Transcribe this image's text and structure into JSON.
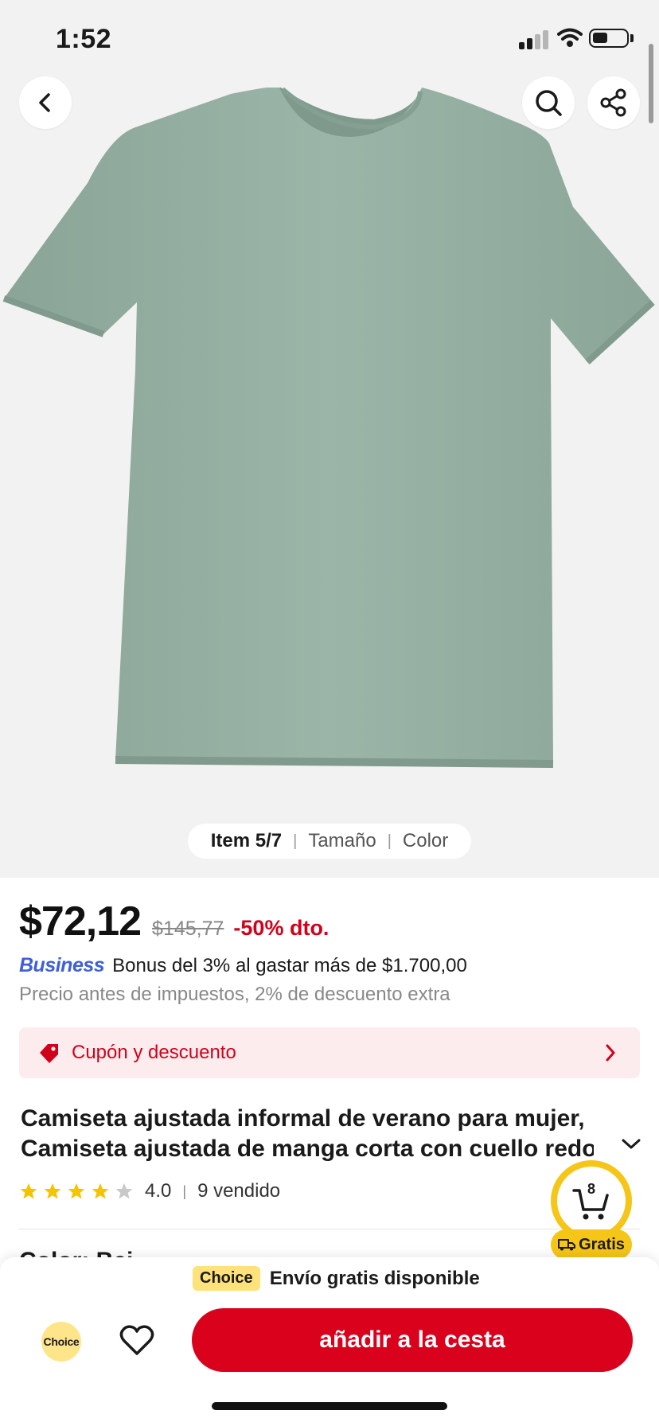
{
  "status_bar": {
    "time": "1:52"
  },
  "gallery": {
    "tabs": [
      {
        "label": "Item 5/7",
        "active": true
      },
      {
        "label": "Tamaño",
        "active": false
      },
      {
        "label": "Color",
        "active": false
      }
    ]
  },
  "price": {
    "current": "$72,12",
    "original": "$145,77",
    "discount": "-50% dto."
  },
  "business": {
    "logo_text": "Business",
    "bonus_text": "Bonus del 3% al gastar más de $1.700,00",
    "tax_note": "Precio antes de impuestos, 2% de descuento extra"
  },
  "coupon": {
    "label": "Cupón y descuento"
  },
  "product": {
    "title_line1": "Camiseta ajustada informal de verano para mujer,",
    "title_line2": "Camiseta ajustada de manga corta con cuello redon",
    "rating": "4.0",
    "rating_stars_filled": 4,
    "rating_stars_total": 5,
    "sold": "9 vendido",
    "next_section_peek": "Color: Bei"
  },
  "cart": {
    "count": "8",
    "shipping_badge": "Gratis"
  },
  "bottom_bar": {
    "choice_badge": "Choice",
    "shipping_text": "Envío gratis disponible",
    "choice_circle": "Choice",
    "add_to_cart": "añadir a la cesta"
  },
  "colors": {
    "accent_red": "#d9011b",
    "discount_red": "#d0021b",
    "choice_yellow": "#f5c518",
    "business_blue": "#3e5fd8",
    "shirt_green": "#95b0a3"
  },
  "icons": [
    "back-icon",
    "search-icon",
    "share-icon",
    "coupon-tag-icon",
    "chevron-right-icon",
    "chevron-down-icon",
    "star-icon",
    "cart-icon",
    "truck-icon",
    "heart-icon"
  ]
}
